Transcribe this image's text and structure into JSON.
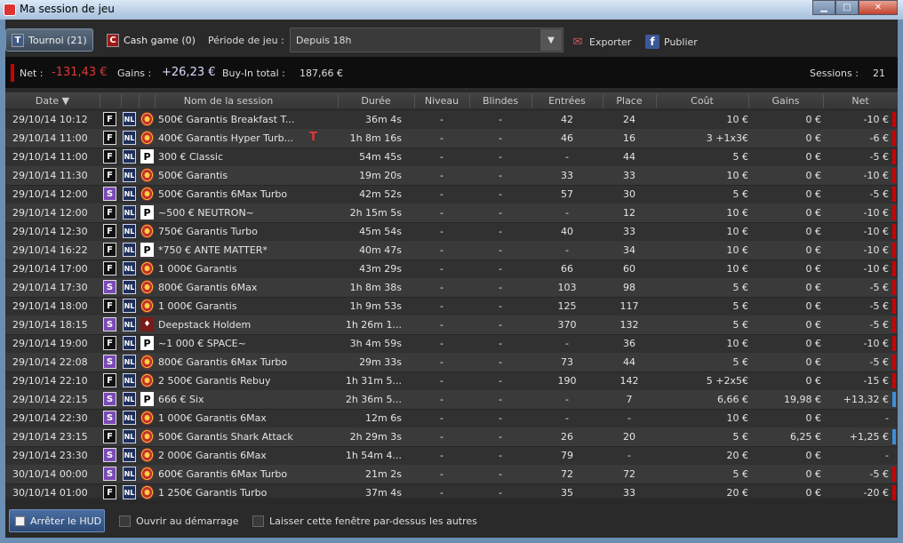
{
  "window": {
    "title": "Ma session de jeu"
  },
  "toolbar": {
    "tournoi_badge": "T",
    "tournoi_label": "Tournoi (21)",
    "cash_badge": "C",
    "cash_label": "Cash game (0)",
    "period_label": "Période de jeu :",
    "period_value": "Depuis 18h",
    "export_label": "Exporter",
    "publish_label": "Publier",
    "facebook_glyph": "f"
  },
  "summary": {
    "net_label": "Net :",
    "net_value": "-131,43 €",
    "gains_label": "Gains :",
    "gains_value": "+26,23 €",
    "buyin_label": "Buy-In total :",
    "buyin_value": "187,66 €",
    "sessions_label": "Sessions :",
    "sessions_value": "21"
  },
  "table": {
    "columns": [
      "Date ▼",
      "Nom de la session",
      "Durée",
      "Niveau",
      "Blindes",
      "Entrées",
      "Place",
      "Coût",
      "Gains",
      "Net"
    ],
    "rows": [
      {
        "date": "29/10/14 10:12",
        "fmt": "F",
        "site": "chip",
        "name": "500€ Garantis Breakfast T...",
        "flag": "",
        "duree": "36m 4s",
        "niveau": "-",
        "blindes": "-",
        "entrees": "42",
        "place": "24",
        "cout": "10 €",
        "gains": "0 €",
        "net": "-10 €",
        "sign": "neg"
      },
      {
        "date": "29/10/14 11:00",
        "fmt": "F",
        "site": "chip",
        "name": "400€ Garantis Hyper Turb...",
        "flag": "T",
        "duree": "1h 8m 16s",
        "niveau": "-",
        "blindes": "-",
        "entrees": "46",
        "place": "16",
        "cout": "3  +1x3€",
        "gains": "0 €",
        "net": "-6 €",
        "sign": "neg"
      },
      {
        "date": "29/10/14 11:00",
        "fmt": "F",
        "site": "p",
        "name": "300 € Classic",
        "flag": "",
        "duree": "54m 45s",
        "niveau": "-",
        "blindes": "-",
        "entrees": "-",
        "place": "44",
        "cout": "5 €",
        "gains": "0 €",
        "net": "-5 €",
        "sign": "neg"
      },
      {
        "date": "29/10/14 11:30",
        "fmt": "F",
        "site": "chip",
        "name": "500€ Garantis",
        "flag": "",
        "duree": "19m 20s",
        "niveau": "-",
        "blindes": "-",
        "entrees": "33",
        "place": "33",
        "cout": "10 €",
        "gains": "0 €",
        "net": "-10 €",
        "sign": "neg"
      },
      {
        "date": "29/10/14 12:00",
        "fmt": "S",
        "site": "chip",
        "name": "500€ Garantis 6Max Turbo",
        "flag": "",
        "duree": "42m 52s",
        "niveau": "-",
        "blindes": "-",
        "entrees": "57",
        "place": "30",
        "cout": "5 €",
        "gains": "0 €",
        "net": "-5 €",
        "sign": "neg"
      },
      {
        "date": "29/10/14 12:00",
        "fmt": "F",
        "site": "p",
        "name": "~500 € NEUTRON~",
        "flag": "",
        "duree": "2h 15m 5s",
        "niveau": "-",
        "blindes": "-",
        "entrees": "-",
        "place": "12",
        "cout": "10 €",
        "gains": "0 €",
        "net": "-10 €",
        "sign": "neg"
      },
      {
        "date": "29/10/14 12:30",
        "fmt": "F",
        "site": "chip",
        "name": "750€ Garantis Turbo",
        "flag": "",
        "duree": "45m 54s",
        "niveau": "-",
        "blindes": "-",
        "entrees": "40",
        "place": "33",
        "cout": "10 €",
        "gains": "0 €",
        "net": "-10 €",
        "sign": "neg"
      },
      {
        "date": "29/10/14 16:22",
        "fmt": "F",
        "site": "p",
        "name": "*750 €  ANTE MATTER*",
        "flag": "",
        "duree": "40m 47s",
        "niveau": "-",
        "blindes": "-",
        "entrees": "-",
        "place": "34",
        "cout": "10 €",
        "gains": "0 €",
        "net": "-10 €",
        "sign": "neg"
      },
      {
        "date": "29/10/14 17:00",
        "fmt": "F",
        "site": "chip",
        "name": "1 000€ Garantis",
        "flag": "",
        "duree": "43m 29s",
        "niveau": "-",
        "blindes": "-",
        "entrees": "66",
        "place": "60",
        "cout": "10 €",
        "gains": "0 €",
        "net": "-10 €",
        "sign": "neg"
      },
      {
        "date": "29/10/14 17:30",
        "fmt": "S",
        "site": "chip",
        "name": "800€ Garantis 6Max",
        "flag": "",
        "duree": "1h 8m 38s",
        "niveau": "-",
        "blindes": "-",
        "entrees": "103",
        "place": "98",
        "cout": "5 €",
        "gains": "0 €",
        "net": "-5 €",
        "sign": "neg"
      },
      {
        "date": "29/10/14 18:00",
        "fmt": "F",
        "site": "chip",
        "name": "1 000€ Garantis",
        "flag": "",
        "duree": "1h 9m 53s",
        "niveau": "-",
        "blindes": "-",
        "entrees": "125",
        "place": "117",
        "cout": "5 €",
        "gains": "0 €",
        "net": "-5 €",
        "sign": "neg"
      },
      {
        "date": "29/10/14 18:15",
        "fmt": "S",
        "site": "d",
        "name": "Deepstack Holdem",
        "flag": "",
        "duree": "1h 26m 1...",
        "niveau": "-",
        "blindes": "-",
        "entrees": "370",
        "place": "132",
        "cout": "5 €",
        "gains": "0 €",
        "net": "-5 €",
        "sign": "neg"
      },
      {
        "date": "29/10/14 19:00",
        "fmt": "F",
        "site": "p",
        "name": "~1 000 € SPACE~",
        "flag": "",
        "duree": "3h 4m 59s",
        "niveau": "-",
        "blindes": "-",
        "entrees": "-",
        "place": "36",
        "cout": "10 €",
        "gains": "0 €",
        "net": "-10 €",
        "sign": "neg"
      },
      {
        "date": "29/10/14 22:08",
        "fmt": "S",
        "site": "chip",
        "name": "800€ Garantis 6Max Turbo",
        "flag": "",
        "duree": "29m 33s",
        "niveau": "-",
        "blindes": "-",
        "entrees": "73",
        "place": "44",
        "cout": "5 €",
        "gains": "0 €",
        "net": "-5 €",
        "sign": "neg"
      },
      {
        "date": "29/10/14 22:10",
        "fmt": "F",
        "site": "chip",
        "name": "2 500€ Garantis Rebuy",
        "flag": "",
        "duree": "1h 31m 5...",
        "niveau": "-",
        "blindes": "-",
        "entrees": "190",
        "place": "142",
        "cout": "5  +2x5€",
        "gains": "0 €",
        "net": "-15 €",
        "sign": "neg"
      },
      {
        "date": "29/10/14 22:15",
        "fmt": "S",
        "site": "p",
        "name": "666 € Six",
        "flag": "",
        "duree": "2h 36m 5...",
        "niveau": "-",
        "blindes": "-",
        "entrees": "-",
        "place": "7",
        "cout": "6,66 €",
        "gains": "19,98 €",
        "net": "+13,32 €",
        "sign": "pos"
      },
      {
        "date": "29/10/14 22:30",
        "fmt": "S",
        "site": "chip",
        "name": "1 000€ Garantis 6Max",
        "flag": "",
        "duree": "12m 6s",
        "niveau": "-",
        "blindes": "-",
        "entrees": "-",
        "place": "-",
        "cout": "10 €",
        "gains": "0 €",
        "net": "-",
        "sign": "none"
      },
      {
        "date": "29/10/14 23:15",
        "fmt": "F",
        "site": "chip",
        "name": "500€ Garantis Shark Attack",
        "flag": "",
        "duree": "2h 29m 3s",
        "niveau": "-",
        "blindes": "-",
        "entrees": "26",
        "place": "20",
        "cout": "5 €",
        "gains": "6,25 €",
        "net": "+1,25 €",
        "sign": "pos"
      },
      {
        "date": "29/10/14 23:30",
        "fmt": "S",
        "site": "chip",
        "name": "2 000€ Garantis 6Max",
        "flag": "",
        "duree": "1h 54m 4...",
        "niveau": "-",
        "blindes": "-",
        "entrees": "79",
        "place": "-",
        "cout": "20 €",
        "gains": "0 €",
        "net": "-",
        "sign": "none"
      },
      {
        "date": "30/10/14 00:00",
        "fmt": "S",
        "site": "chip",
        "name": "600€ Garantis 6Max Turbo",
        "flag": "",
        "duree": "21m 2s",
        "niveau": "-",
        "blindes": "-",
        "entrees": "72",
        "place": "72",
        "cout": "5 €",
        "gains": "0 €",
        "net": "-5 €",
        "sign": "neg"
      },
      {
        "date": "30/10/14 01:00",
        "fmt": "F",
        "site": "chip",
        "name": "1 250€ Garantis Turbo",
        "flag": "",
        "duree": "37m 4s",
        "niveau": "-",
        "blindes": "-",
        "entrees": "35",
        "place": "33",
        "cout": "20 €",
        "gains": "0 €",
        "net": "-20 €",
        "sign": "neg"
      }
    ]
  },
  "footer": {
    "stop_label": "Arrêter le HUD",
    "startup_label": "Ouvrir au démarrage",
    "ontop_label": "Laisser cette fenêtre par-dessus les autres"
  }
}
